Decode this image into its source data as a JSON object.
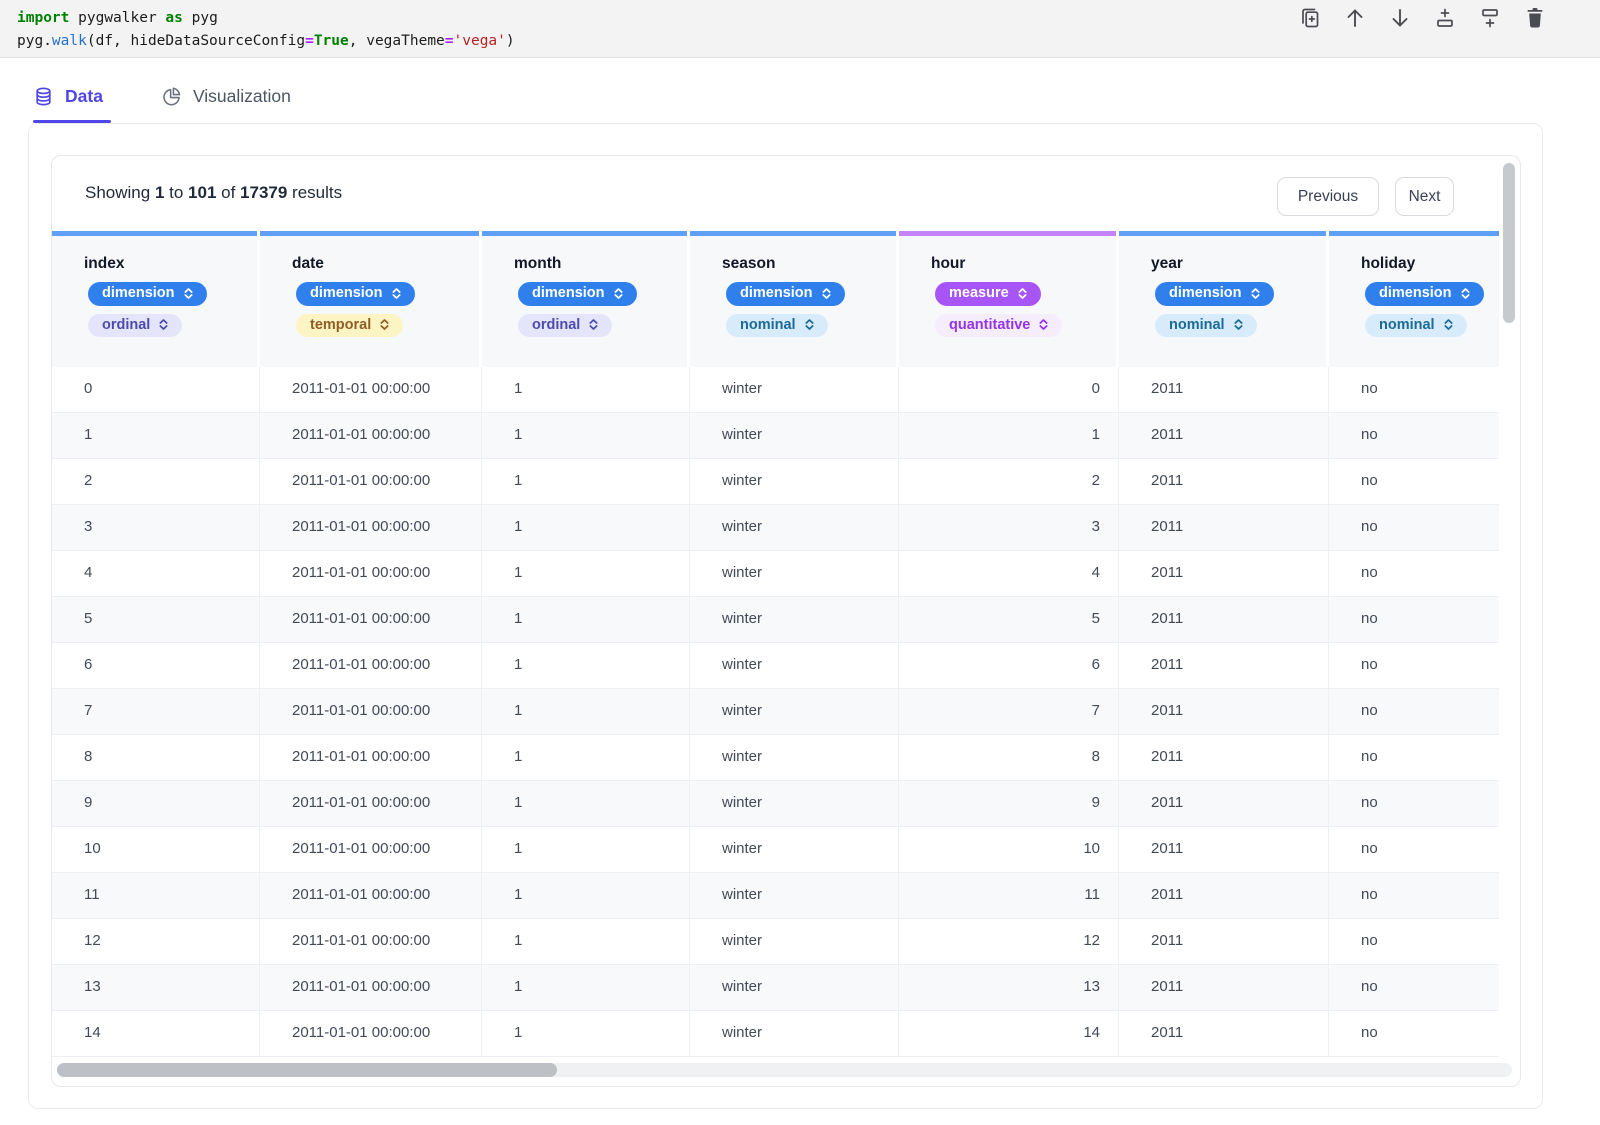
{
  "colors": {
    "accent_indigo": "#4f46e5",
    "strip_blue": "#60a0f4",
    "strip_purple": "#c583f7",
    "role_dimension": "#2f80ec",
    "role_measure": "#a855f7",
    "type_ordinal_bg": "#e4e5fa",
    "type_ordinal_fg": "#4d4cac",
    "type_temporal_bg": "#fdf4c3",
    "type_temporal_fg": "#8f5e22",
    "type_nominal_bg": "#d8ebfa",
    "type_nominal_fg": "#1b6b96",
    "type_quantitative_bg": "#f5ecfc",
    "type_quantitative_fg": "#9333ea",
    "code_keyword": "#008000",
    "code_function": "#2472c8",
    "code_operator": "#aa22ff",
    "code_string": "#ba2121"
  },
  "code": {
    "lines": [
      [
        {
          "text": "import",
          "cls": "kw"
        },
        {
          "text": " pygwalker ",
          "cls": "plain"
        },
        {
          "text": "as",
          "cls": "kw"
        },
        {
          "text": " pyg",
          "cls": "plain"
        }
      ],
      [
        {
          "text": "pyg.",
          "cls": "plain"
        },
        {
          "text": "walk",
          "cls": "fn"
        },
        {
          "text": "(df, hideDataSourceConfig",
          "cls": "plain"
        },
        {
          "text": "=",
          "cls": "op"
        },
        {
          "text": "True",
          "cls": "kw"
        },
        {
          "text": ", vegaTheme",
          "cls": "plain"
        },
        {
          "text": "=",
          "cls": "op"
        },
        {
          "text": "'vega'",
          "cls": "str"
        },
        {
          "text": ")",
          "cls": "plain"
        }
      ]
    ]
  },
  "toolbar": {
    "icons": [
      "duplicate-cell-icon",
      "move-up-icon",
      "move-down-icon",
      "insert-cell-above-icon",
      "insert-cell-below-icon",
      "delete-cell-icon"
    ]
  },
  "tabs": [
    {
      "label": "Data",
      "icon": "database-icon",
      "active": true
    },
    {
      "label": "Visualization",
      "icon": "pie-chart-icon",
      "active": false
    }
  ],
  "pagination": {
    "segments": [
      {
        "text": "Showing ",
        "bold": false
      },
      {
        "text": "1",
        "bold": true
      },
      {
        "text": " to ",
        "bold": false
      },
      {
        "text": "101",
        "bold": true
      },
      {
        "text": " of ",
        "bold": false
      },
      {
        "text": "17379",
        "bold": true
      },
      {
        "text": " results",
        "bold": false
      }
    ],
    "previous_label": "Previous",
    "next_label": "Next"
  },
  "table": {
    "columns": [
      {
        "name": "index",
        "role": "dimension",
        "type": "ordinal",
        "accent": "blue"
      },
      {
        "name": "date",
        "role": "dimension",
        "type": "temporal",
        "accent": "blue"
      },
      {
        "name": "month",
        "role": "dimension",
        "type": "ordinal",
        "accent": "blue"
      },
      {
        "name": "season",
        "role": "dimension",
        "type": "nominal",
        "accent": "blue"
      },
      {
        "name": "hour",
        "role": "measure",
        "type": "quantitative",
        "accent": "purple"
      },
      {
        "name": "year",
        "role": "dimension",
        "type": "nominal",
        "accent": "blue"
      },
      {
        "name": "holiday",
        "role": "dimension",
        "type": "nominal",
        "accent": "blue"
      }
    ],
    "rows": [
      [
        "0",
        "2011-01-01 00:00:00",
        "1",
        "winter",
        "0",
        "2011",
        "no"
      ],
      [
        "1",
        "2011-01-01 00:00:00",
        "1",
        "winter",
        "1",
        "2011",
        "no"
      ],
      [
        "2",
        "2011-01-01 00:00:00",
        "1",
        "winter",
        "2",
        "2011",
        "no"
      ],
      [
        "3",
        "2011-01-01 00:00:00",
        "1",
        "winter",
        "3",
        "2011",
        "no"
      ],
      [
        "4",
        "2011-01-01 00:00:00",
        "1",
        "winter",
        "4",
        "2011",
        "no"
      ],
      [
        "5",
        "2011-01-01 00:00:00",
        "1",
        "winter",
        "5",
        "2011",
        "no"
      ],
      [
        "6",
        "2011-01-01 00:00:00",
        "1",
        "winter",
        "6",
        "2011",
        "no"
      ],
      [
        "7",
        "2011-01-01 00:00:00",
        "1",
        "winter",
        "7",
        "2011",
        "no"
      ],
      [
        "8",
        "2011-01-01 00:00:00",
        "1",
        "winter",
        "8",
        "2011",
        "no"
      ],
      [
        "9",
        "2011-01-01 00:00:00",
        "1",
        "winter",
        "9",
        "2011",
        "no"
      ],
      [
        "10",
        "2011-01-01 00:00:00",
        "1",
        "winter",
        "10",
        "2011",
        "no"
      ],
      [
        "11",
        "2011-01-01 00:00:00",
        "1",
        "winter",
        "11",
        "2011",
        "no"
      ],
      [
        "12",
        "2011-01-01 00:00:00",
        "1",
        "winter",
        "12",
        "2011",
        "no"
      ],
      [
        "13",
        "2011-01-01 00:00:00",
        "1",
        "winter",
        "13",
        "2011",
        "no"
      ],
      [
        "14",
        "2011-01-01 00:00:00",
        "1",
        "winter",
        "14",
        "2011",
        "no"
      ]
    ]
  }
}
